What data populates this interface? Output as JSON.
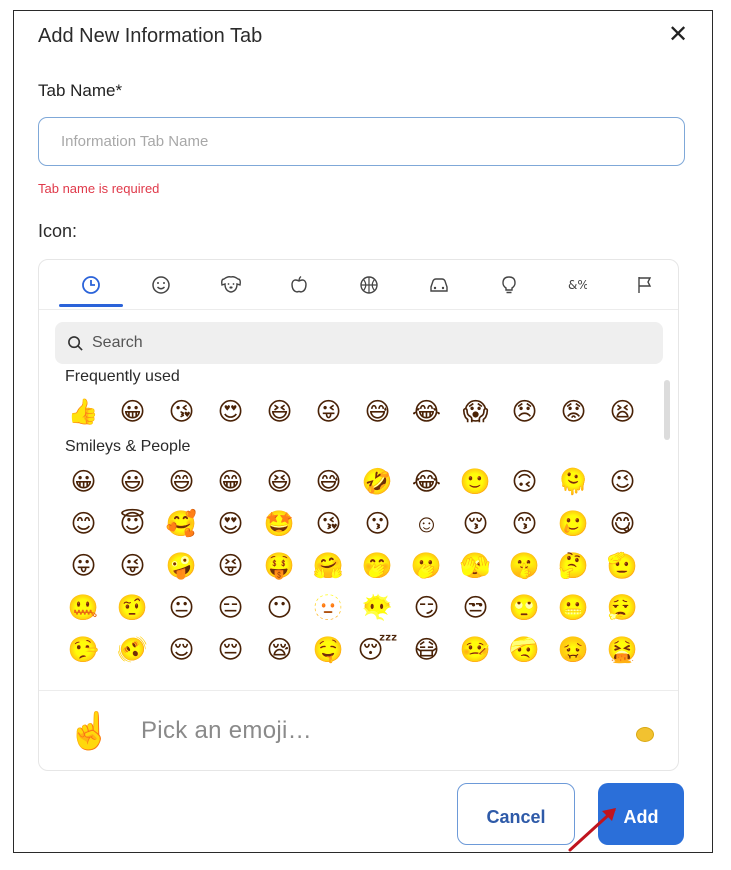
{
  "dialog": {
    "title": "Add New Information Tab",
    "close_symbol": "✕"
  },
  "form": {
    "tab_name_label": "Tab Name*",
    "tab_name_value": "",
    "tab_name_placeholder": "Information Tab Name",
    "error_text": "Tab name is required",
    "icon_label": "Icon:"
  },
  "picker": {
    "categories": [
      {
        "name": "recent-icon",
        "glyph": "🕓",
        "active": true
      },
      {
        "name": "smiley-icon",
        "glyph": "☺"
      },
      {
        "name": "animal-icon",
        "glyph": "🐶"
      },
      {
        "name": "food-icon",
        "glyph": "🍎"
      },
      {
        "name": "activity-icon",
        "glyph": "🏀"
      },
      {
        "name": "travel-icon",
        "glyph": "🚗"
      },
      {
        "name": "objects-icon",
        "glyph": "💡"
      },
      {
        "name": "symbols-icon",
        "glyph": "%"
      },
      {
        "name": "flags-icon",
        "glyph": "🏳"
      }
    ],
    "search": {
      "placeholder": "Search",
      "value": ""
    },
    "sections": [
      {
        "title": "Frequently used",
        "rows": [
          [
            "👍",
            "😀",
            "😘",
            "😍",
            "😆",
            "😜",
            "😅",
            "😂",
            "😱",
            "😞",
            "😟",
            "😫"
          ]
        ]
      },
      {
        "title": "Smileys & People",
        "rows": [
          [
            "😀",
            "😃",
            "😄",
            "😁",
            "😆",
            "😅",
            "🤣",
            "😂",
            "🙂",
            "🙃",
            "🫠",
            "😉"
          ],
          [
            "😊",
            "😇",
            "🥰",
            "😍",
            "🤩",
            "😘",
            "😗",
            "☺",
            "😚",
            "😙",
            "🥲",
            "😋"
          ],
          [
            "😛",
            "😜",
            "🤪",
            "😝",
            "🤑",
            "🤗",
            "🤭",
            "🫢",
            "🫣",
            "🤫",
            "🤔",
            "🫡"
          ],
          [
            "🤐",
            "🤨",
            "😐",
            "😑",
            "😶",
            "🫥",
            "😶‍🌫️",
            "😏",
            "😒",
            "🙄",
            "😬",
            "😮‍💨"
          ],
          [
            "🤥",
            "🫨",
            "😌",
            "😔",
            "😪",
            "🤤",
            "😴",
            "😷",
            "🤒",
            "🤕",
            "🤢",
            "🤮"
          ]
        ]
      }
    ],
    "preview": {
      "emoji": "☝️",
      "text": "Pick an emoji…"
    },
    "skin_tone_color": "#f2c230"
  },
  "buttons": {
    "cancel_label": "Cancel",
    "add_label": "Add",
    "accent_color": "#2b6fd9"
  },
  "colors": {
    "error": "#e0394a",
    "active_tab": "#2b63d9",
    "annotation_arrow": "#c0141e"
  }
}
